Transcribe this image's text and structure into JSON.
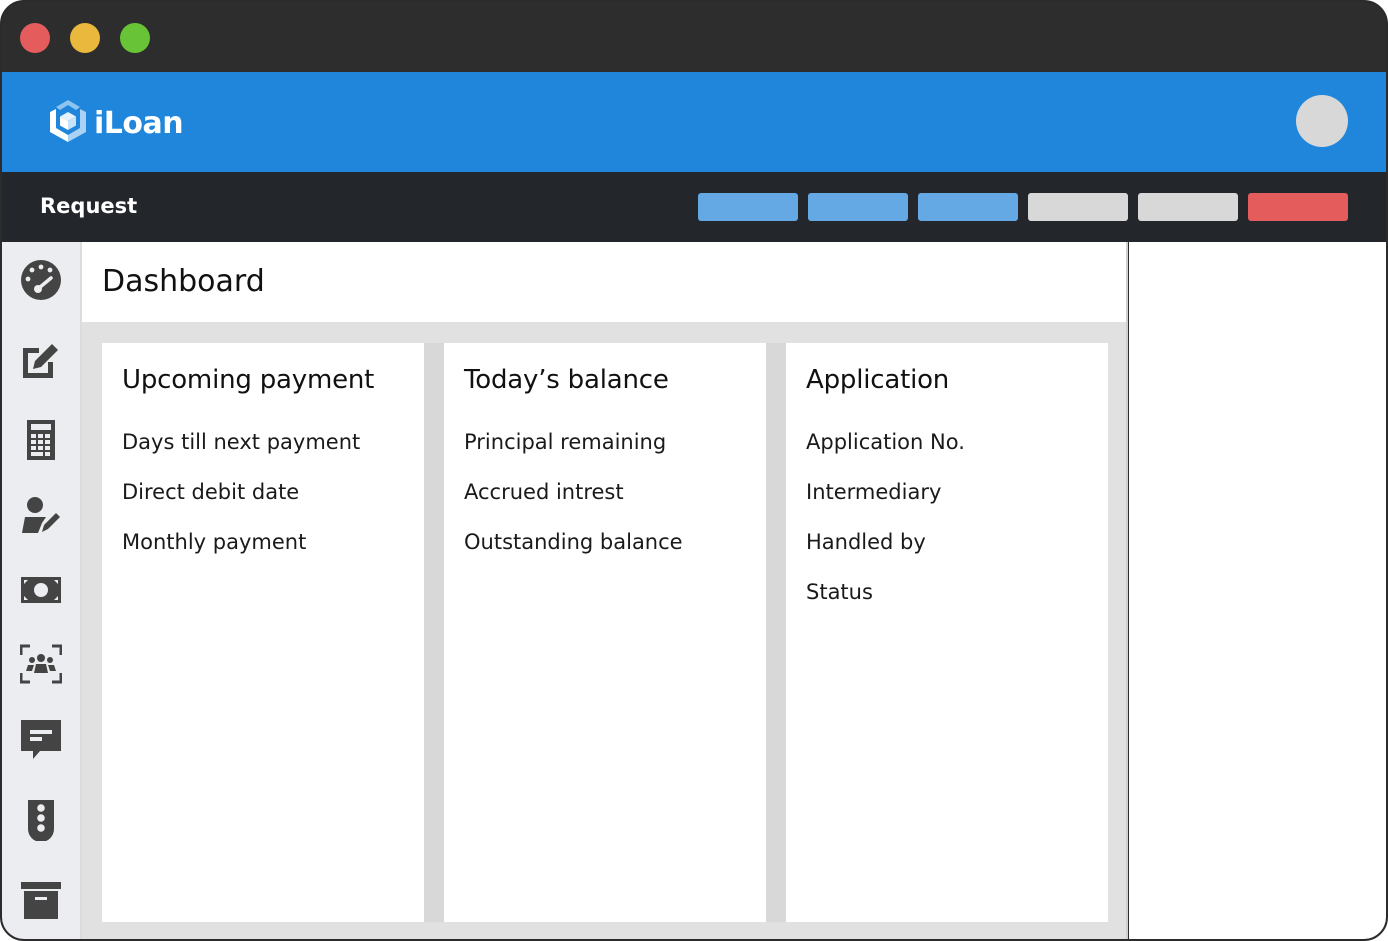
{
  "window": {
    "controls": [
      "close",
      "minimize",
      "maximize"
    ],
    "colors": {
      "close": "#e45c5c",
      "minimize": "#e9b83c",
      "maximize": "#68c436"
    }
  },
  "appbar": {
    "brand": "iLoan",
    "logo_icon": "cube-hexagon-icon",
    "avatar_icon": "user-avatar",
    "color": "#1f86db"
  },
  "subbar": {
    "title": "Request",
    "actions": [
      {
        "label": "",
        "color": "#64a8e4",
        "state": "active"
      },
      {
        "label": "",
        "color": "#64a8e4",
        "state": "active"
      },
      {
        "label": "",
        "color": "#64a8e4",
        "state": "active"
      },
      {
        "label": "",
        "color": "#d8d8d8",
        "state": "inactive"
      },
      {
        "label": "",
        "color": "#d8d8d8",
        "state": "inactive"
      },
      {
        "label": "",
        "color": "#e45c5c",
        "state": "danger"
      }
    ]
  },
  "sidebar": {
    "items": [
      {
        "icon": "dashboard-gauge-icon"
      },
      {
        "icon": "edit-icon"
      },
      {
        "icon": "calculator-icon"
      },
      {
        "icon": "user-edit-icon"
      },
      {
        "icon": "money-icon"
      },
      {
        "icon": "group-icon"
      },
      {
        "icon": "message-icon"
      },
      {
        "icon": "traffic-light-icon"
      },
      {
        "icon": "archive-icon"
      }
    ]
  },
  "main": {
    "title": "Dashboard",
    "cards": [
      {
        "title": "Upcoming payment",
        "items": [
          "Days till next payment",
          "Direct debit date",
          "Monthly payment"
        ]
      },
      {
        "title": "Today’s balance",
        "items": [
          "Principal remaining",
          "Accrued intrest",
          "Outstanding balance"
        ]
      },
      {
        "title": "Application",
        "items": [
          "Application No.",
          "Intermediary",
          "Handled by",
          "Status"
        ]
      }
    ]
  }
}
